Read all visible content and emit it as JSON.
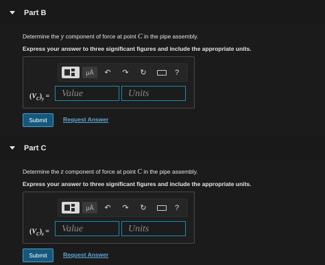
{
  "parts": [
    {
      "title": "Part B",
      "question_pre": "Determine the ",
      "component": "y",
      "question_mid": " component of force at point ",
      "point": "C",
      "question_post": " in the pipe assembly.",
      "instruction": "Express your answer to three significant figures and include the appropriate units.",
      "var_main": "V",
      "var_sub": "C",
      "var_comp": "y",
      "value_placeholder": "Value",
      "units_placeholder": "Units",
      "submit_label": "Submit",
      "request_label": "Request Answer"
    },
    {
      "title": "Part C",
      "question_pre": "Determine the ",
      "component": "z",
      "question_mid": " component of force at point ",
      "point": "C",
      "question_post": " in the pipe assembly.",
      "instruction": "Express your answer to three significant figures and include the appropriate units.",
      "var_main": "V",
      "var_sub": "C",
      "var_comp": "z",
      "value_placeholder": "Value",
      "units_placeholder": "Units",
      "submit_label": "Submit",
      "request_label": "Request Answer"
    }
  ],
  "toolbar": {
    "units_symbol": "μÅ",
    "undo_glyph": "↶",
    "redo_glyph": "↷",
    "reset_glyph": "↻",
    "help_glyph": "?",
    "icons": [
      "templates-icon",
      "units-icon",
      "undo-icon",
      "redo-icon",
      "reset-icon",
      "keyboard-icon",
      "help-icon"
    ]
  },
  "colors": {
    "background": "#1b1b1b",
    "accent_border": "#1d8bb5",
    "submit_bg": "#15587d",
    "link": "#5ea8d8"
  }
}
